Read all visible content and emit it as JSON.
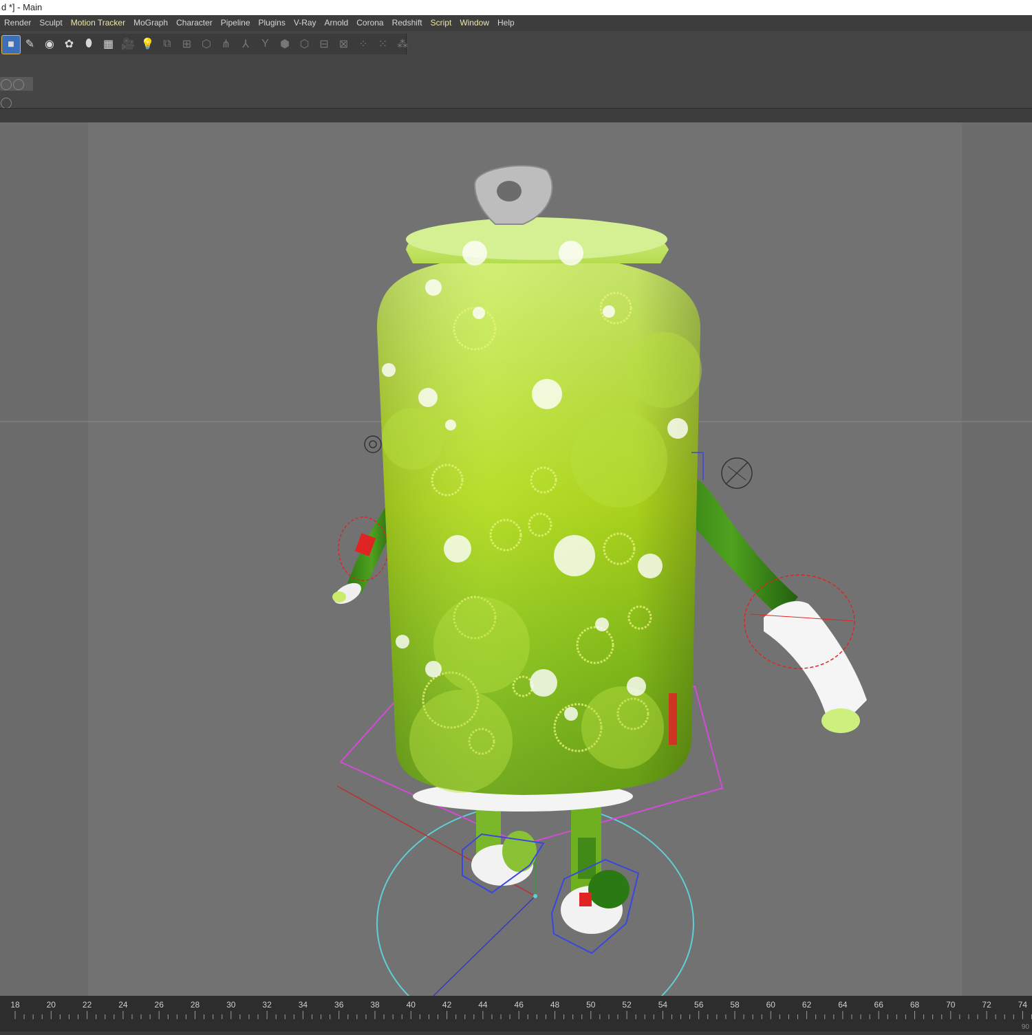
{
  "window": {
    "title": "d *] - Main"
  },
  "menu": [
    {
      "label": "Render",
      "highlight": false
    },
    {
      "label": "Sculpt",
      "highlight": false
    },
    {
      "label": "Motion Tracker",
      "highlight": true
    },
    {
      "label": "MoGraph",
      "highlight": false
    },
    {
      "label": "Character",
      "highlight": false
    },
    {
      "label": "Pipeline",
      "highlight": false
    },
    {
      "label": "Plugins",
      "highlight": false
    },
    {
      "label": "V-Ray",
      "highlight": false
    },
    {
      "label": "Arnold",
      "highlight": false
    },
    {
      "label": "Corona",
      "highlight": false
    },
    {
      "label": "Redshift",
      "highlight": false
    },
    {
      "label": "Script",
      "highlight": true
    },
    {
      "label": "Window",
      "highlight": true
    },
    {
      "label": "Help",
      "highlight": false
    }
  ],
  "toolbar": {
    "icons": [
      {
        "name": "cube-icon",
        "glyph": "■",
        "active": true
      },
      {
        "name": "pen-spline-icon",
        "glyph": "✎",
        "active": true
      },
      {
        "name": "subdivision-icon",
        "glyph": "◉",
        "active": true
      },
      {
        "name": "array-icon",
        "glyph": "✿",
        "active": true
      },
      {
        "name": "deformer-icon",
        "glyph": "⬮",
        "active": true
      },
      {
        "name": "floor-icon",
        "glyph": "▦",
        "active": true
      },
      {
        "name": "camera-icon",
        "glyph": "🎥",
        "active": true
      },
      {
        "name": "light-icon",
        "glyph": "💡",
        "active": true
      },
      {
        "name": "joint-tool-icon",
        "glyph": "⧉",
        "active": false
      },
      {
        "name": "bone-icon",
        "glyph": "⊞",
        "active": false
      },
      {
        "name": "cage-icon",
        "glyph": "⬡",
        "active": false
      },
      {
        "name": "ik-chain-icon",
        "glyph": "⋔",
        "active": false
      },
      {
        "name": "skeleton-icon",
        "glyph": "⅄",
        "active": false
      },
      {
        "name": "y-joint-icon",
        "glyph": "Y",
        "active": false
      },
      {
        "name": "weight-icon",
        "glyph": "⬢",
        "active": false
      },
      {
        "name": "mesh-icon",
        "glyph": "⬡",
        "active": false
      },
      {
        "name": "hierarchy-icon",
        "glyph": "⊟",
        "active": false
      },
      {
        "name": "hierarchy-down-icon",
        "glyph": "⊠",
        "active": false
      },
      {
        "name": "grid-a-icon",
        "glyph": "⁘",
        "active": false
      },
      {
        "name": "grid-b-icon",
        "glyph": "⁙",
        "active": false
      },
      {
        "name": "grid-c-icon",
        "glyph": "⁂",
        "active": false
      }
    ]
  },
  "timeline": {
    "ticks": [
      "18",
      "20",
      "22",
      "24",
      "26",
      "28",
      "30",
      "32",
      "34",
      "36",
      "38",
      "40",
      "42",
      "44",
      "46",
      "48",
      "50",
      "52",
      "54",
      "56",
      "58",
      "60",
      "62",
      "64",
      "66",
      "68",
      "70",
      "72",
      "74"
    ],
    "end_label": "90"
  },
  "colors": {
    "can_green_light": "#d6f07a",
    "can_green_mid": "#a8d21c",
    "can_green_dark": "#5a9a12",
    "selection_magenta": "#d24cd8",
    "controller_red": "#e02424",
    "controller_cyan": "#5ed0d6",
    "controller_blue": "#3a46e0"
  }
}
